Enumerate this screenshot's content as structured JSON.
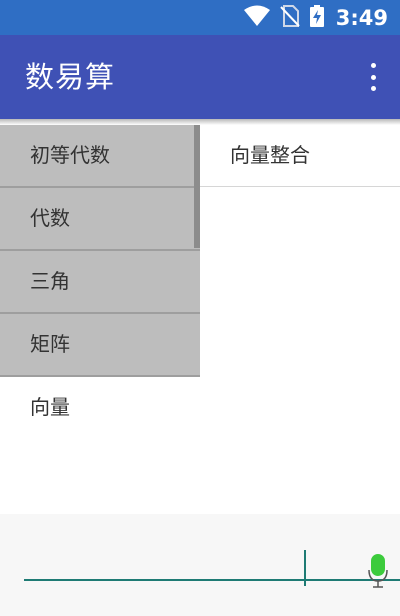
{
  "status_bar": {
    "time": "3:49",
    "icons": [
      "wifi-icon",
      "no-sim-icon",
      "battery-charging-icon"
    ]
  },
  "app_bar": {
    "title": "数易算",
    "menu_icon": "overflow-menu-icon"
  },
  "categories": [
    {
      "label": "初等代数"
    },
    {
      "label": "代数"
    },
    {
      "label": "三角"
    },
    {
      "label": "矩阵"
    },
    {
      "label": "向量"
    }
  ],
  "subitems": [
    {
      "label": "向量整合"
    }
  ],
  "input": {
    "value": "",
    "mic_icon": "microphone-icon"
  },
  "colors": {
    "status_bar": "#2f6ec4",
    "app_bar": "#3f51b5",
    "accent": "#1e7b74",
    "mic": "#3ccb3c"
  }
}
